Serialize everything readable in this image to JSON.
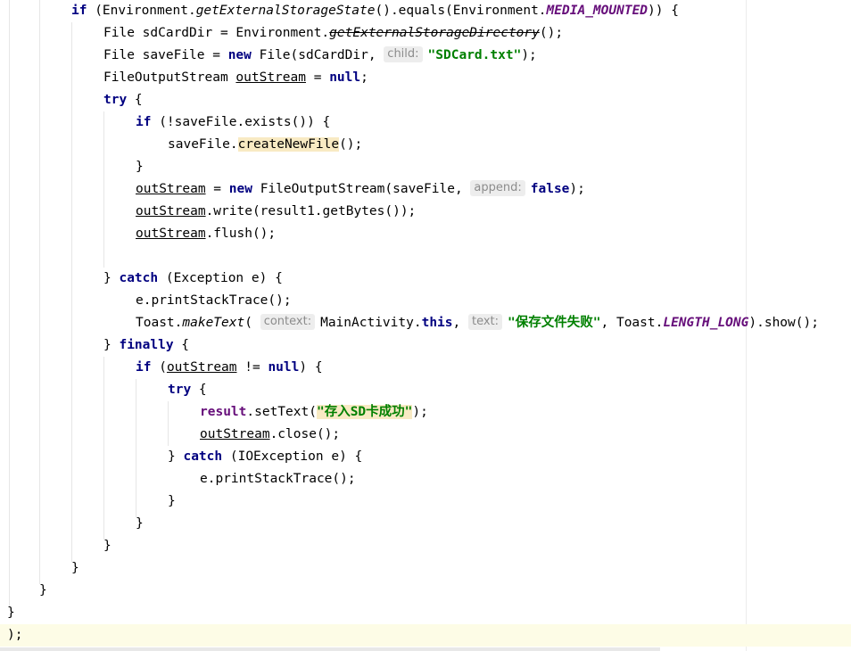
{
  "code": {
    "l1": {
      "kw1": "if",
      "a": " (Environment.",
      "m1": "getExternalStorageState",
      "b": "().equals(Environment.",
      "c1": "MEDIA_MOUNTED",
      "c": ")) {"
    },
    "l2": {
      "a": "File sdCardDir = Environment.",
      "m1": "getExternalStorageDirectory",
      "b": "();"
    },
    "l3": {
      "a": "File saveFile = ",
      "kw1": "new",
      "b": " File(sdCardDir, ",
      "hint": "child:",
      "s1": "\"SDCard.txt\"",
      "c": ");"
    },
    "l4": {
      "a": "FileOutputStream ",
      "v1": "outStream",
      "b": " = ",
      "kw1": "null",
      "c": ";"
    },
    "l5": {
      "kw1": "try",
      "a": " {"
    },
    "l6": {
      "kw1": "if",
      "a": " (!saveFile.exists()) {"
    },
    "l7": {
      "a": "saveFile.",
      "m1": "createNewFile",
      "b": "();"
    },
    "l8": {
      "a": "}"
    },
    "l9": {
      "v1": "outStream",
      "a": " = ",
      "kw1": "new",
      "b": " FileOutputStream(saveFile, ",
      "hint": "append:",
      "kw2": "false",
      "c": ");"
    },
    "l10": {
      "v1": "outStream",
      "a": ".write(result1.getBytes());"
    },
    "l11": {
      "v1": "outStream",
      "a": ".flush();"
    },
    "l13": {
      "a": "} ",
      "kw1": "catch",
      "b": " (Exception e) {"
    },
    "l14": {
      "a": "e.printStackTrace();"
    },
    "l15": {
      "a": "Toast.",
      "m1": "makeText",
      "b": "( ",
      "hint1": "context:",
      "c": "MainActivity.",
      "kw1": "this",
      "d": ", ",
      "hint2": "text:",
      "s1": "\"保存文件失败\"",
      "e": ", Toast.",
      "c1": "LENGTH_LONG",
      "f": ").show();"
    },
    "l16": {
      "a": "} ",
      "kw1": "finally",
      "b": " {"
    },
    "l17": {
      "kw1": "if",
      "a": " (",
      "v1": "outStream",
      "b": " != ",
      "kw2": "null",
      "c": ") {"
    },
    "l18": {
      "kw1": "try",
      "a": " {"
    },
    "l19": {
      "f1": "result",
      "a": ".setText(",
      "s1": "\"存入SD卡成功\"",
      "b": ");"
    },
    "l20": {
      "v1": "outStream",
      "a": ".close();"
    },
    "l21": {
      "a": "} ",
      "kw1": "catch",
      "b": " (IOException e) {"
    },
    "l22": {
      "a": "e.printStackTrace();"
    },
    "l23": {
      "a": "}"
    },
    "l24": {
      "a": "}"
    },
    "l25": {
      "a": "}"
    },
    "l26": {
      "a": "}"
    },
    "l27": {
      "a": "}"
    },
    "l28": {
      "a": "}"
    },
    "l29": {
      "a": ");"
    }
  }
}
